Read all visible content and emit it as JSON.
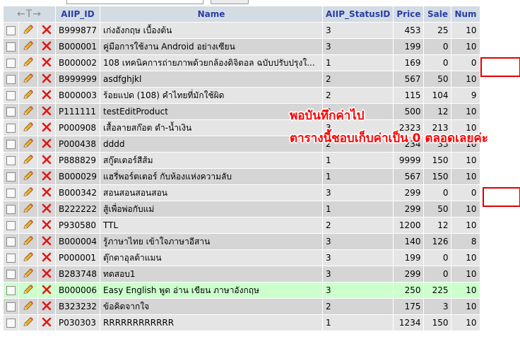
{
  "header": {
    "arrows": "←T→",
    "columns": [
      "AIIP_ID",
      "Name",
      "AIIP_StatusID",
      "Price",
      "Sale",
      "Num"
    ]
  },
  "rows": [
    {
      "id": "B999877",
      "name": "เก่งอังกฤษ เบื้องต้น",
      "status": "3",
      "price": "453",
      "sale": "25",
      "num": "10"
    },
    {
      "id": "B000001",
      "name": "คู่มือการใช้งาน Android อย่างเซียน",
      "status": "3",
      "price": "199",
      "sale": "0",
      "num": "10"
    },
    {
      "id": "B000002",
      "name": "108 เทคนิคการถ่ายภาพด้วยกล้องดิจิตอล ฉบับปรับปรุงใ...",
      "status": "1",
      "price": "169",
      "sale": "0",
      "num": "0"
    },
    {
      "id": "B999999",
      "name": "asdfghjkl",
      "status": "2",
      "price": "567",
      "sale": "50",
      "num": "10"
    },
    {
      "id": "B000003",
      "name": "ร้อยแปด (108) คำไทยที่มักใช้ผิด",
      "status": "2",
      "price": "115",
      "sale": "104",
      "num": "9"
    },
    {
      "id": "P111111",
      "name": "testEditProduct",
      "status": "2",
      "price": "500",
      "sale": "12",
      "num": "10"
    },
    {
      "id": "P000908",
      "name": "เสื้อลายสก๊อต ดำ-น้ำเงิน",
      "status": "3",
      "price": "2323",
      "sale": "213",
      "num": "10"
    },
    {
      "id": "P000438",
      "name": "dddd",
      "status": "2",
      "price": "234",
      "sale": "33",
      "num": "10"
    },
    {
      "id": "P888829",
      "name": "สกู๊ตเตอร์สีส้ม",
      "status": "1",
      "price": "9999",
      "sale": "150",
      "num": "10"
    },
    {
      "id": "B000029",
      "name": "แฮรี่พอร์ตเตอร์ กับห้องแห่งความลับ",
      "status": "1",
      "price": "567",
      "sale": "150",
      "num": "10"
    },
    {
      "id": "B000342",
      "name": "สอนสอนสอนสอน",
      "status": "3",
      "price": "299",
      "sale": "0",
      "num": "0"
    },
    {
      "id": "B222222",
      "name": "สู้เพื่อพ่อกับแม่",
      "status": "1",
      "price": "299",
      "sale": "50",
      "num": "10"
    },
    {
      "id": "P930580",
      "name": "TTL",
      "status": "2",
      "price": "1200",
      "sale": "12",
      "num": "10"
    },
    {
      "id": "B000004",
      "name": "รู้ภาษาไทย เข้าใจภาษาอีสาน",
      "status": "3",
      "price": "140",
      "sale": "126",
      "num": "8"
    },
    {
      "id": "P000001",
      "name": "ตุ๊กตาอุลต้าแมน",
      "status": "3",
      "price": "199",
      "sale": "0",
      "num": "10"
    },
    {
      "id": "B283748",
      "name": "ทดสอบ1",
      "status": "3",
      "price": "299",
      "sale": "0",
      "num": "10"
    },
    {
      "id": "B000006",
      "name": "Easy English พูด อ่าน เขียน ภาษาอังกฤษ",
      "status": "3",
      "price": "250",
      "sale": "225",
      "num": "10"
    },
    {
      "id": "B323232",
      "name": "ข้อคิดจากใจ",
      "status": "2",
      "price": "175",
      "sale": "3",
      "num": "10"
    },
    {
      "id": "P030303",
      "name": "RRRRRRRRRRRR",
      "status": "1",
      "price": "1234",
      "sale": "150",
      "num": "10"
    }
  ],
  "highlight_row_id": "B000006",
  "annotation": {
    "line1": "พอบันทึกค่าไป",
    "line2": "ตารางนี้ชอบเก็บค่าเป็น 0 ตลอดเลยค่ะ"
  },
  "colors": {
    "header_bg": "#d3dce3",
    "header_text": "#2a3ea6",
    "row_light": "#e5e5e5",
    "row_dark": "#d5d5d5",
    "row_highlight": "#ccffcc",
    "annotation_red": "#ff0000"
  },
  "icons": {
    "edit": "pencil-icon",
    "delete": "red-x-delete-icon",
    "select": "checkbox"
  }
}
